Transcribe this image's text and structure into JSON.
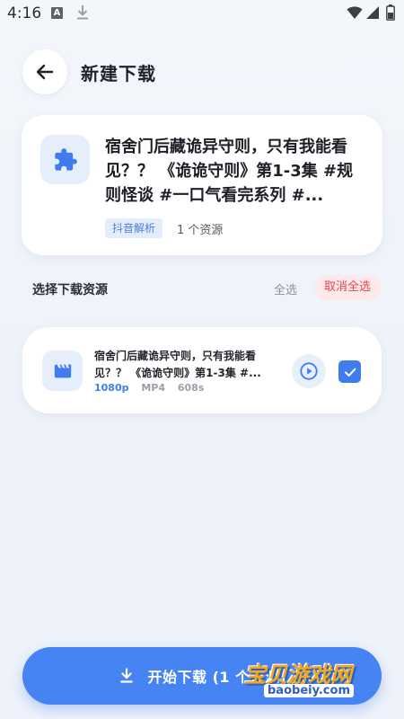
{
  "status_bar": {
    "time": "4:16",
    "a_badge": "A"
  },
  "header": {
    "title": "新建下载"
  },
  "info": {
    "title": "宿舍门后藏诡异守则，只有我能看见？？ 《诡诡守则》第1-3集 #规则怪谈 #一口气看完系列 #...",
    "source_tag": "抖音解析",
    "resource_count": "1 个资源"
  },
  "section": {
    "label": "选择下载资源",
    "select_all": "全选",
    "deselect_all": "取消全选"
  },
  "resources": [
    {
      "title": "宿舍门后藏诡异守则，只有我能看见？？ 《诡诡守则》第1-3集 #...",
      "resolution": "1080p",
      "format": "MP4",
      "duration": "608s",
      "checked": true
    }
  ],
  "footer": {
    "download_label": "开始下载 (1 个资源)"
  },
  "watermark": {
    "text": "宝贝游戏网",
    "url": "baobeiy.com"
  },
  "colors": {
    "accent": "#4584f2",
    "danger": "#e2474f",
    "tag_bg": "#e4edfb"
  },
  "icons": {
    "back": "arrow-left-icon",
    "puzzle": "puzzle-icon",
    "clapper": "clapperboard-icon",
    "play": "play-circle-icon",
    "check": "check-icon",
    "download": "download-icon"
  }
}
